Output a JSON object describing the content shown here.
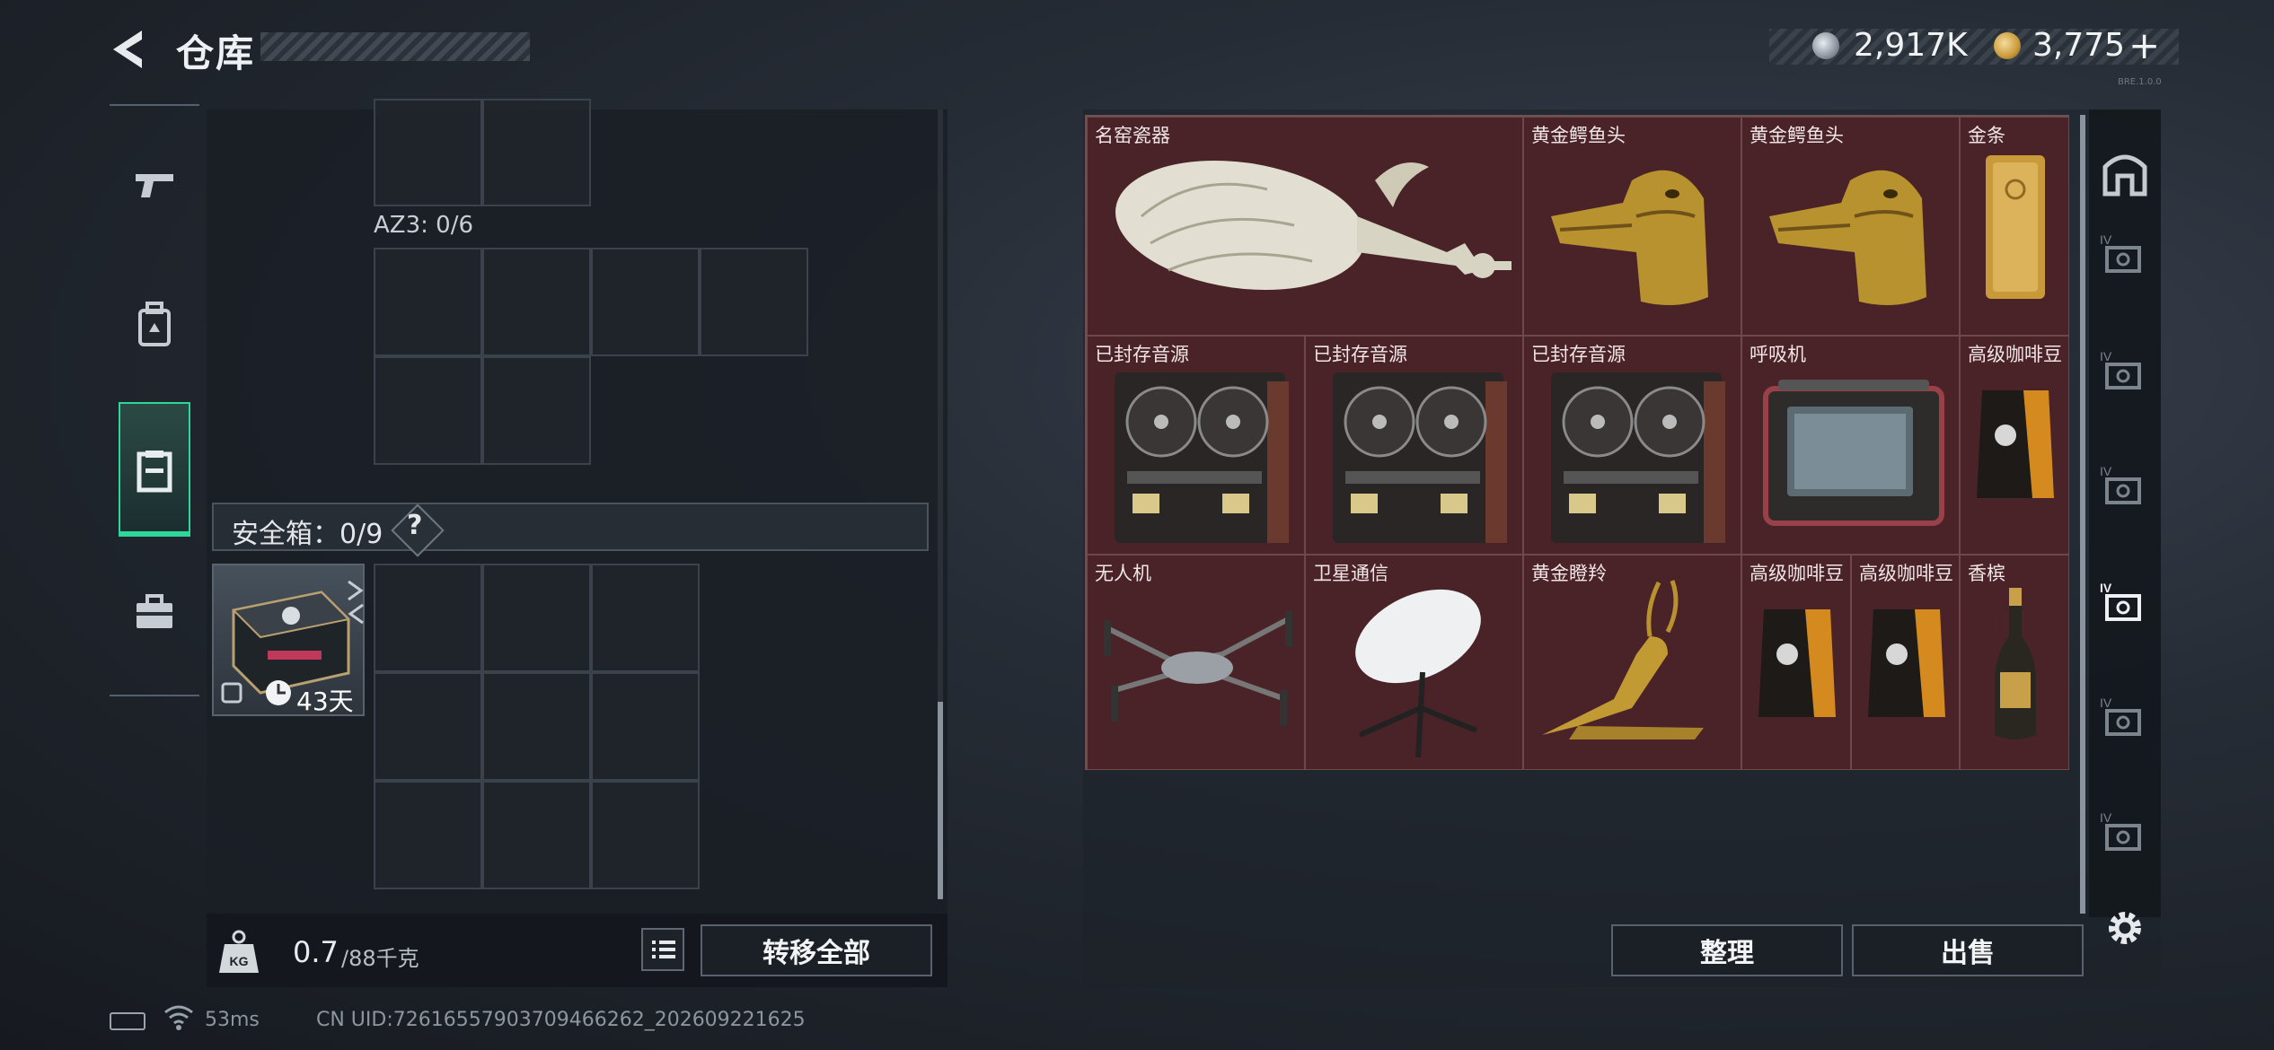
{
  "header": {
    "title": "仓库"
  },
  "currency": {
    "silver": "2,917K",
    "gold": "3,775",
    "gold_plus": "+"
  },
  "version_text": "BRE.1.0.0",
  "left_nav": {
    "items": [
      "gun-icon",
      "backpack-icon",
      "storage-icon",
      "toolbox-icon"
    ],
    "active": "storage-icon"
  },
  "container": {
    "az3_label": "AZ3: 0/6",
    "safe_label": "安全箱：0/9",
    "safe_help": "?",
    "safebox_days": "43天"
  },
  "weight": {
    "current": "0.7",
    "max": "/88千克"
  },
  "buttons": {
    "transfer_all": "转移全部",
    "organize": "整理",
    "sell": "出售"
  },
  "items": [
    {
      "name": "名窑瓷器",
      "icon": "porcelain-vase"
    },
    {
      "name": "黄金鳄鱼头",
      "icon": "gold-crocodile-head"
    },
    {
      "name": "黄金鳄鱼头",
      "icon": "gold-crocodile-head"
    },
    {
      "name": "金条",
      "icon": "gold-bar"
    },
    {
      "name": "已封存音源",
      "icon": "reel-to-reel-recorder"
    },
    {
      "name": "已封存音源",
      "icon": "reel-to-reel-recorder"
    },
    {
      "name": "已封存音源",
      "icon": "reel-to-reel-recorder"
    },
    {
      "name": "呼吸机",
      "icon": "ventilator"
    },
    {
      "name": "高级咖啡豆",
      "icon": "coffee-bag"
    },
    {
      "name": "无人机",
      "icon": "drone"
    },
    {
      "name": "卫星通信",
      "icon": "satellite-dish"
    },
    {
      "name": "黄金瞪羚",
      "icon": "gold-gazelle"
    },
    {
      "name": "高级咖啡豆",
      "icon": "coffee-bag"
    },
    {
      "name": "高级咖啡豆",
      "icon": "coffee-bag"
    },
    {
      "name": "香槟",
      "icon": "champagne-bottle"
    }
  ],
  "right_rail": {
    "items": [
      "home-icon",
      "cash-tier-icon",
      "cash-tier-icon",
      "cash-tier-icon",
      "cash-tier-icon",
      "cash-tier-icon",
      "cash-tier-icon"
    ],
    "active_index": 4,
    "rail_label": "IV"
  },
  "footer": {
    "ping": "53ms",
    "uid": "CN UID:7261655790370946626​2_202609221625"
  },
  "colors": {
    "accent": "#2fd69a",
    "slot_bg": "#4a2329",
    "gold": "#c99a3a"
  }
}
